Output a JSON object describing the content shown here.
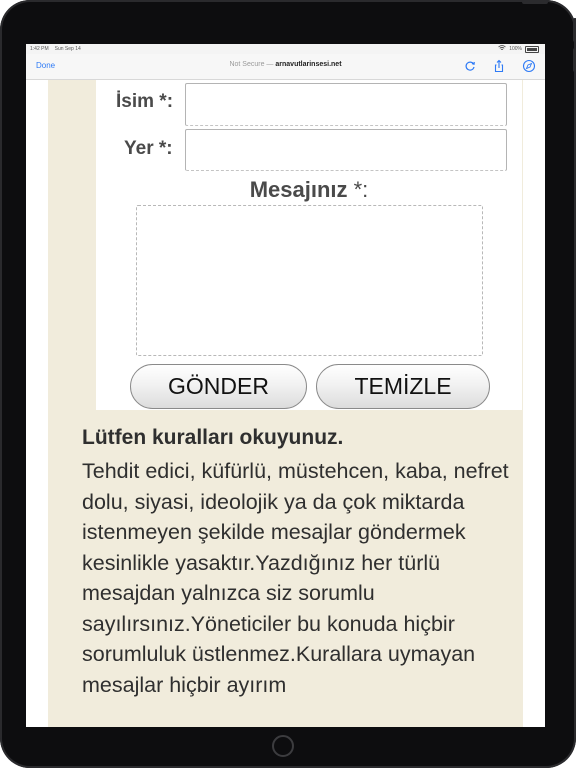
{
  "statusbar": {
    "time": "1:42 PM",
    "date": "Sun Sep 14",
    "battery": "100%"
  },
  "browser": {
    "done_label": "Done",
    "not_secure": "Not Secure —",
    "domain": "arnavutlarinsesi.net",
    "icons": [
      "reload-icon",
      "share-icon",
      "compass-icon"
    ]
  },
  "form": {
    "name_label": "İsim *:",
    "name_value": "",
    "place_label": "Yer *:",
    "place_value": "",
    "message_label": "Mesajınız",
    "message_suffix": " *:",
    "message_value": "",
    "submit_label": "GÖNDER",
    "reset_label": "TEMİZLE"
  },
  "rules": {
    "title": "Lütfen kuralları okuyunuz.",
    "text": "Tehdit edici, küfürlü, müstehcen, kaba, nefret dolu, siyasi, ideolojik ya da çok miktarda istenmeyen şekilde mesajlar göndermek kesinlikle yasaktır.Yazdığınız her türlü mesajdan yalnızca siz sorumlu sayılırsınız.Yöneticiler bu konuda hiçbir sorumluluk üstlenmez.Kurallara uymayan mesajlar hiçbir ayırım"
  },
  "colors": {
    "bezel": "#0d0d0f",
    "page_background": "#f1ecdc",
    "accent": "#2f7bf6",
    "text": "#2f2f2f"
  }
}
